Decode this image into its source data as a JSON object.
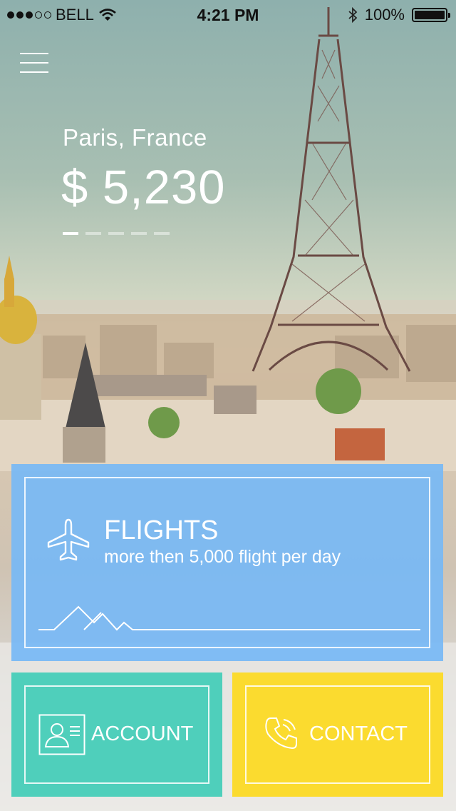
{
  "status_bar": {
    "carrier": "BELL",
    "time": "4:21 PM",
    "battery": "100%",
    "signal_bars_filled": 3,
    "signal_bars_total": 5
  },
  "hero": {
    "location": "Paris, France",
    "price": "$ 5,230",
    "pager": {
      "total": 5,
      "active_index": 0
    }
  },
  "tiles": {
    "flights": {
      "title": "FLIGHTS",
      "subtitle": "more then 5,000 flight per day",
      "icon": "airplane-icon",
      "color": "#77b9f5"
    },
    "account": {
      "label": "ACCOUNT",
      "icon": "id-card-icon",
      "color": "#4fcfbb"
    },
    "contact": {
      "label": "CONTACT",
      "icon": "phone-icon",
      "color": "#fbdb2f"
    }
  },
  "icons": {
    "menu": "hamburger-menu-icon",
    "wifi": "wifi-icon",
    "bluetooth": "bluetooth-icon",
    "battery": "battery-icon"
  }
}
